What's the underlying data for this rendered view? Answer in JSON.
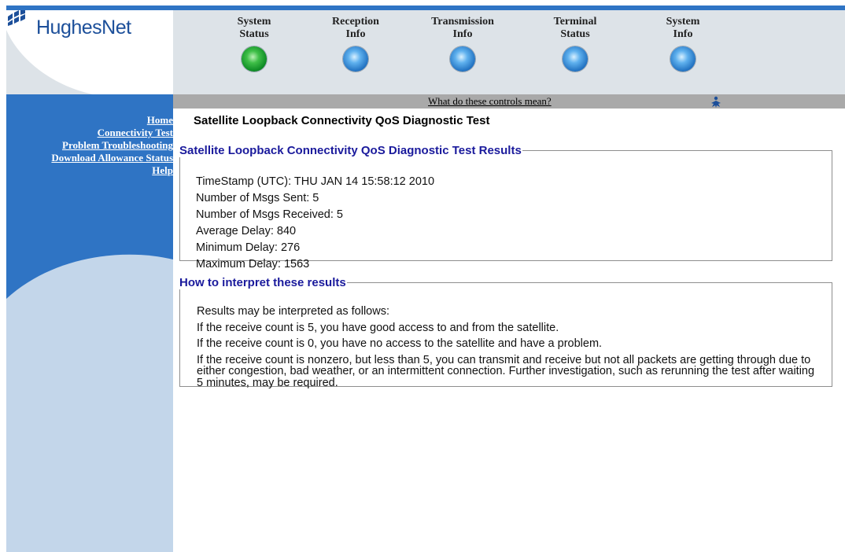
{
  "brand": {
    "name": "HughesNet",
    "logo_mark": "satellite-grid-icon"
  },
  "status_nav": [
    {
      "label": "System\nStatus",
      "indicator": "green"
    },
    {
      "label": "Reception\nInfo",
      "indicator": "blue"
    },
    {
      "label": "Transmission\nInfo",
      "indicator": "blue"
    },
    {
      "label": "Terminal\nStatus",
      "indicator": "blue"
    },
    {
      "label": "System\nInfo",
      "indicator": "blue"
    }
  ],
  "controls_help": {
    "label": "What do these controls mean?",
    "icon": "help-figure-icon"
  },
  "sidebar": {
    "links": [
      "Home",
      "Connectivity Test",
      "Problem Troubleshooting",
      "Download Allowance Status",
      "Help"
    ]
  },
  "page": {
    "title": "Satellite Loopback Connectivity QoS Diagnostic Test",
    "results": {
      "legend": "Satellite Loopback Connectivity QoS Diagnostic Test Results",
      "lines": [
        "TimeStamp (UTC): THU JAN 14 15:58:12 2010",
        "Number of Msgs Sent: 5",
        "Number of Msgs Received: 5",
        "Average Delay: 840",
        "Minimum Delay: 276",
        "Maximum Delay: 1563"
      ]
    },
    "interpretation": {
      "legend": "How to interpret these results",
      "lines": [
        "Results may be interpreted as follows:",
        "If the receive count is 5, you have good access to and from the satellite.",
        "If the receive count is 0, you have no access to the satellite and have a problem.",
        "If the receive count is nonzero, but less than 5, you can transmit and receive but not all packets are getting through due to either congestion, bad weather, or an intermittent connection. Further investigation, such as rerunning the test after waiting 5 minutes, may be required."
      ]
    }
  },
  "colors": {
    "brand_blue": "#2f74c4",
    "header_bg": "#dde3e8",
    "legend_text": "#1a1a9c",
    "status_ok": "#1ba33a",
    "status_info": "#2f80d0"
  }
}
